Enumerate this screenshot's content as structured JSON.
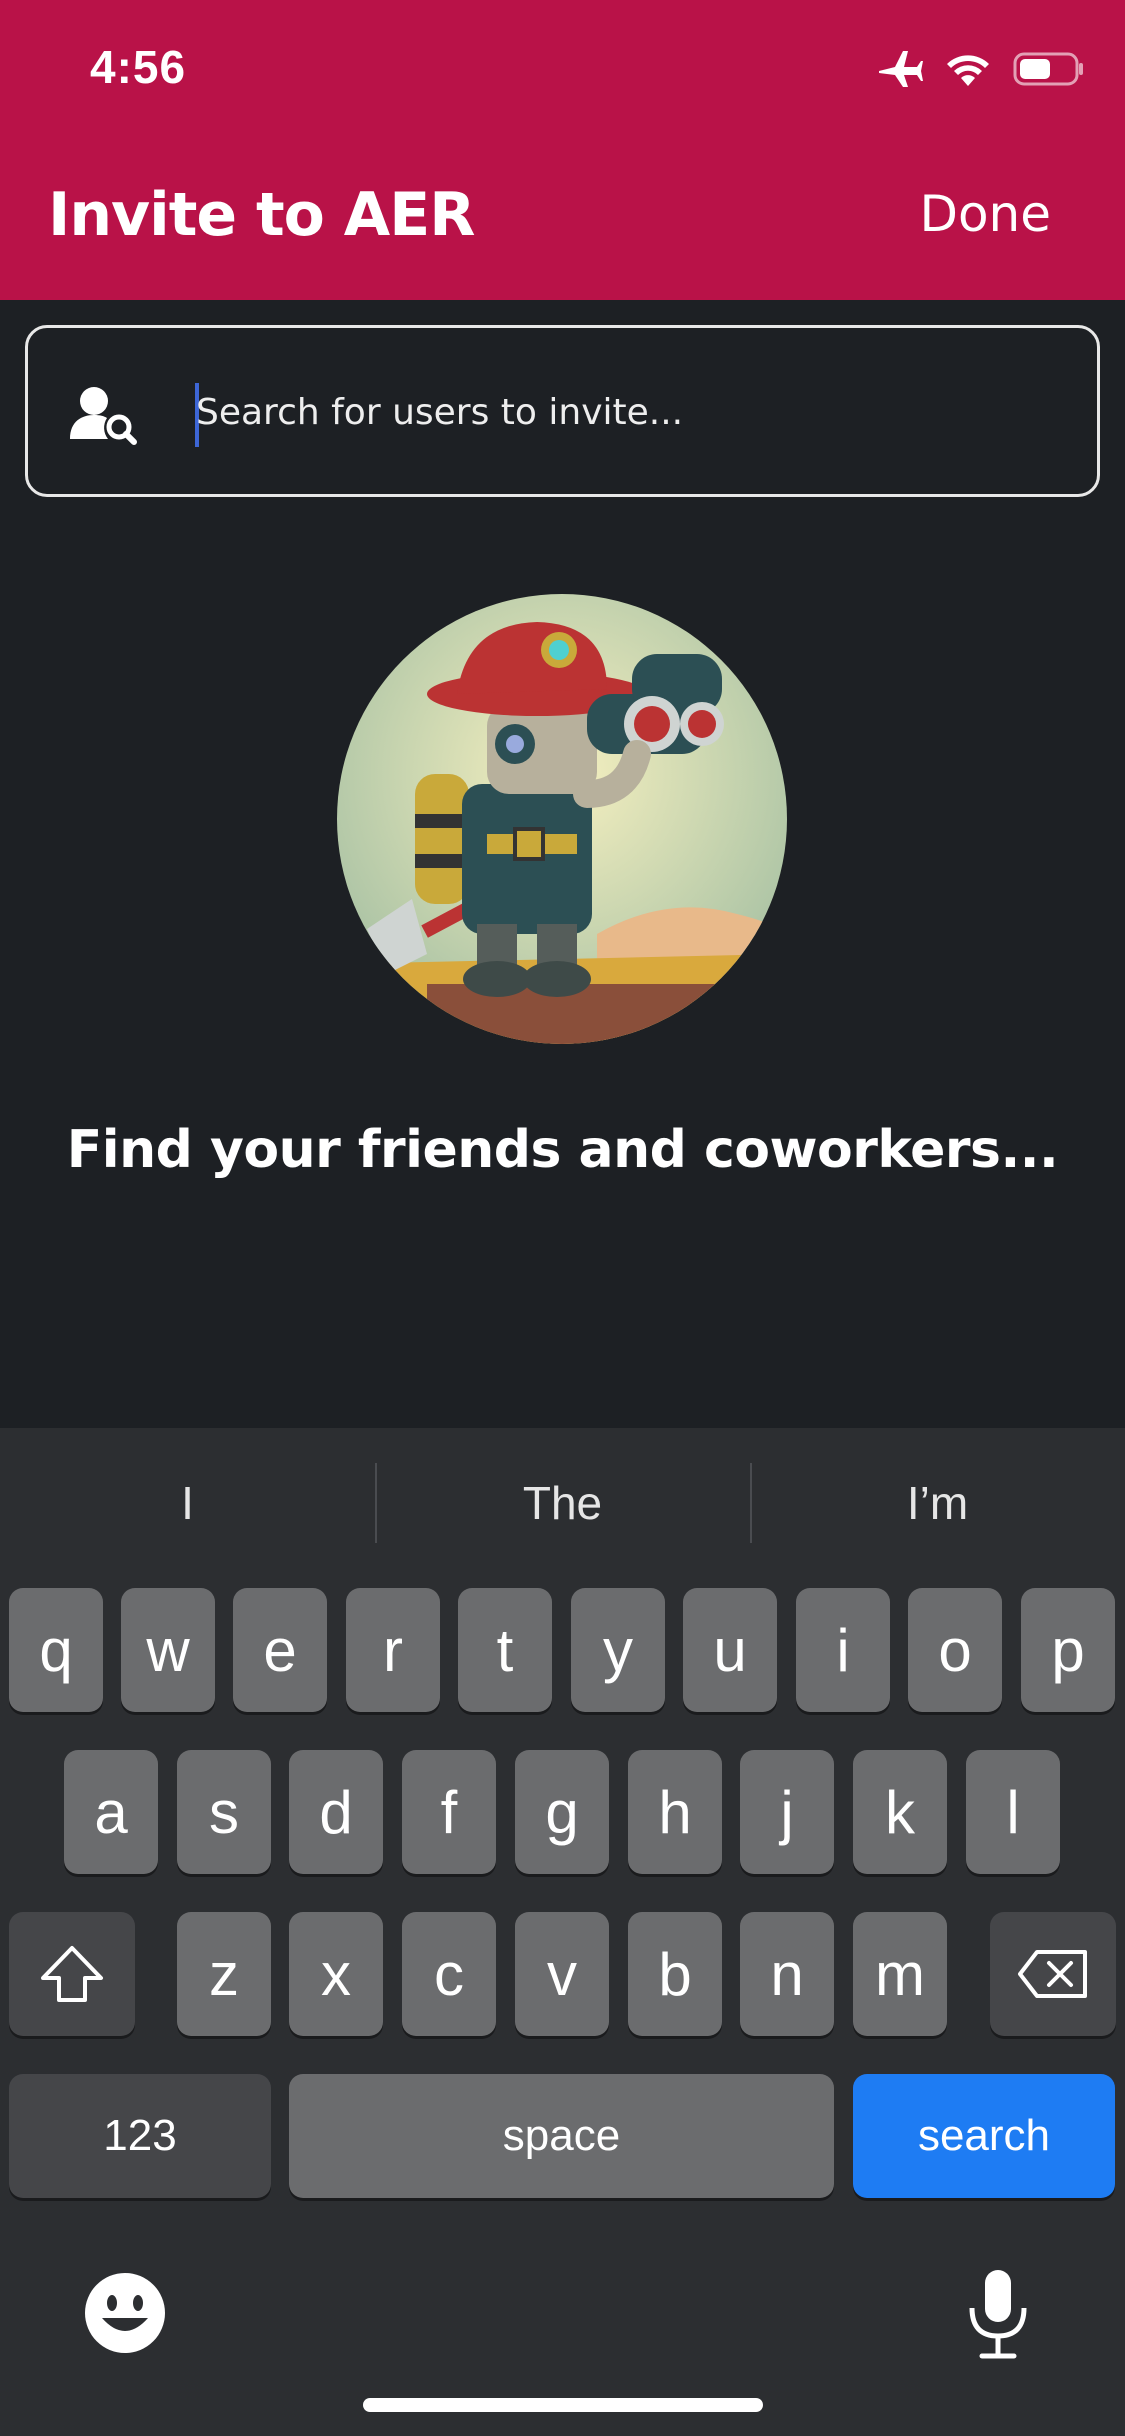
{
  "status_bar": {
    "time": "4:56"
  },
  "header": {
    "title": "Invite to AER",
    "done_label": "Done"
  },
  "search": {
    "placeholder": "Search for users to invite..."
  },
  "main": {
    "tagline": "Find your friends and coworkers..."
  },
  "keyboard": {
    "suggestions": [
      "I",
      "The",
      "I’m"
    ],
    "row1": [
      "q",
      "w",
      "e",
      "r",
      "t",
      "y",
      "u",
      "i",
      "o",
      "p"
    ],
    "row2": [
      "a",
      "s",
      "d",
      "f",
      "g",
      "h",
      "j",
      "k",
      "l"
    ],
    "row3": [
      "z",
      "x",
      "c",
      "v",
      "b",
      "n",
      "m"
    ],
    "numbers_label": "123",
    "space_label": "space",
    "search_label": "search"
  },
  "colors": {
    "header": "#b91248",
    "background": "#1d2024",
    "accent": "#1e7cf3"
  }
}
